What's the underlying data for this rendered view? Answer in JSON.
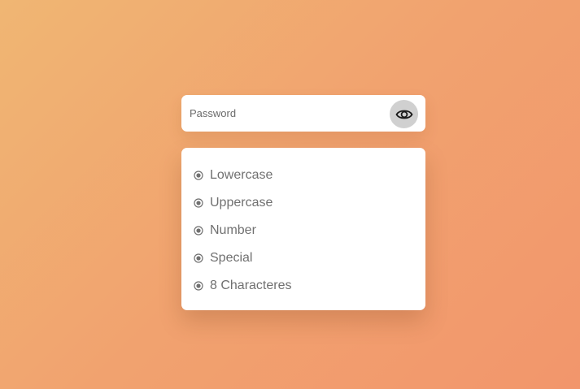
{
  "password_field": {
    "placeholder": "Password",
    "value": "",
    "toggle_icon": "eye-icon"
  },
  "requirements": {
    "bullet_icon": "radio-dot-icon",
    "items": [
      {
        "label": "Lowercase"
      },
      {
        "label": "Uppercase"
      },
      {
        "label": "Number"
      },
      {
        "label": "Special"
      },
      {
        "label": "8 Characteres"
      }
    ]
  },
  "colors": {
    "background_start": "#f0b673",
    "background_end": "#f2966c",
    "card": "#ffffff",
    "toggle_bg": "#d0d0d0",
    "text": "#707070"
  }
}
